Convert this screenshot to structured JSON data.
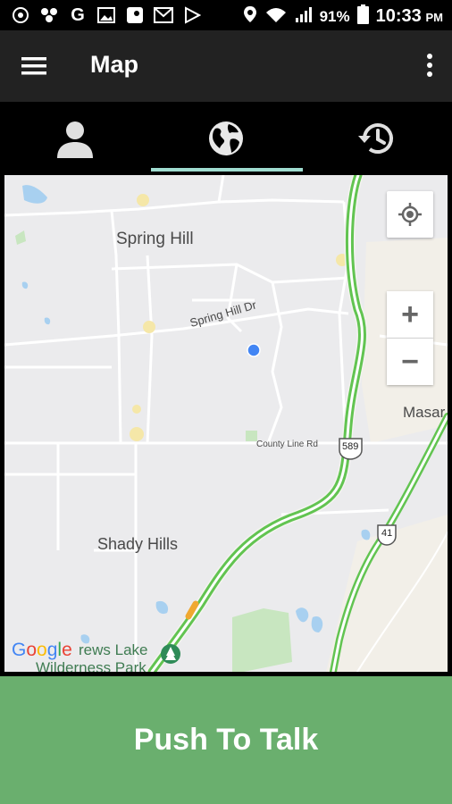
{
  "status_bar": {
    "battery": "91%",
    "time": "10:33",
    "ampm": "PM",
    "icons": [
      "alarm-icon",
      "dots-icon",
      "google-icon",
      "image-icon",
      "maps-icon",
      "gmail-icon",
      "play-store-icon",
      "location-icon",
      "wifi-calling-icon",
      "signal-icon",
      "battery-icon"
    ]
  },
  "app_bar": {
    "title": "Map",
    "icons": [
      "menu-icon",
      "overflow-icon"
    ]
  },
  "tabs": [
    {
      "icon": "person-icon",
      "selected": false
    },
    {
      "icon": "globe-icon",
      "selected": true
    },
    {
      "icon": "history-icon",
      "selected": false
    }
  ],
  "map": {
    "labels": {
      "spring_hill": "Spring Hill",
      "spring_hill_dr": "Spring Hill Dr",
      "county_line_rd": "County Line Rd",
      "shady_hills": "Shady Hills",
      "masaryk": "Masar",
      "park_line1": "rews Lake",
      "park_line2": "Wilderness Park",
      "shield_589": "589",
      "shield_41": "41"
    },
    "controls": {
      "zoom_in": "+",
      "zoom_out": "−"
    },
    "logo": "Google",
    "colors": {
      "road_green": "#62c451",
      "accent_blue": "#4285f4"
    }
  },
  "push_to_talk": {
    "label": "Push To Talk",
    "color": "#6aaf6e"
  }
}
